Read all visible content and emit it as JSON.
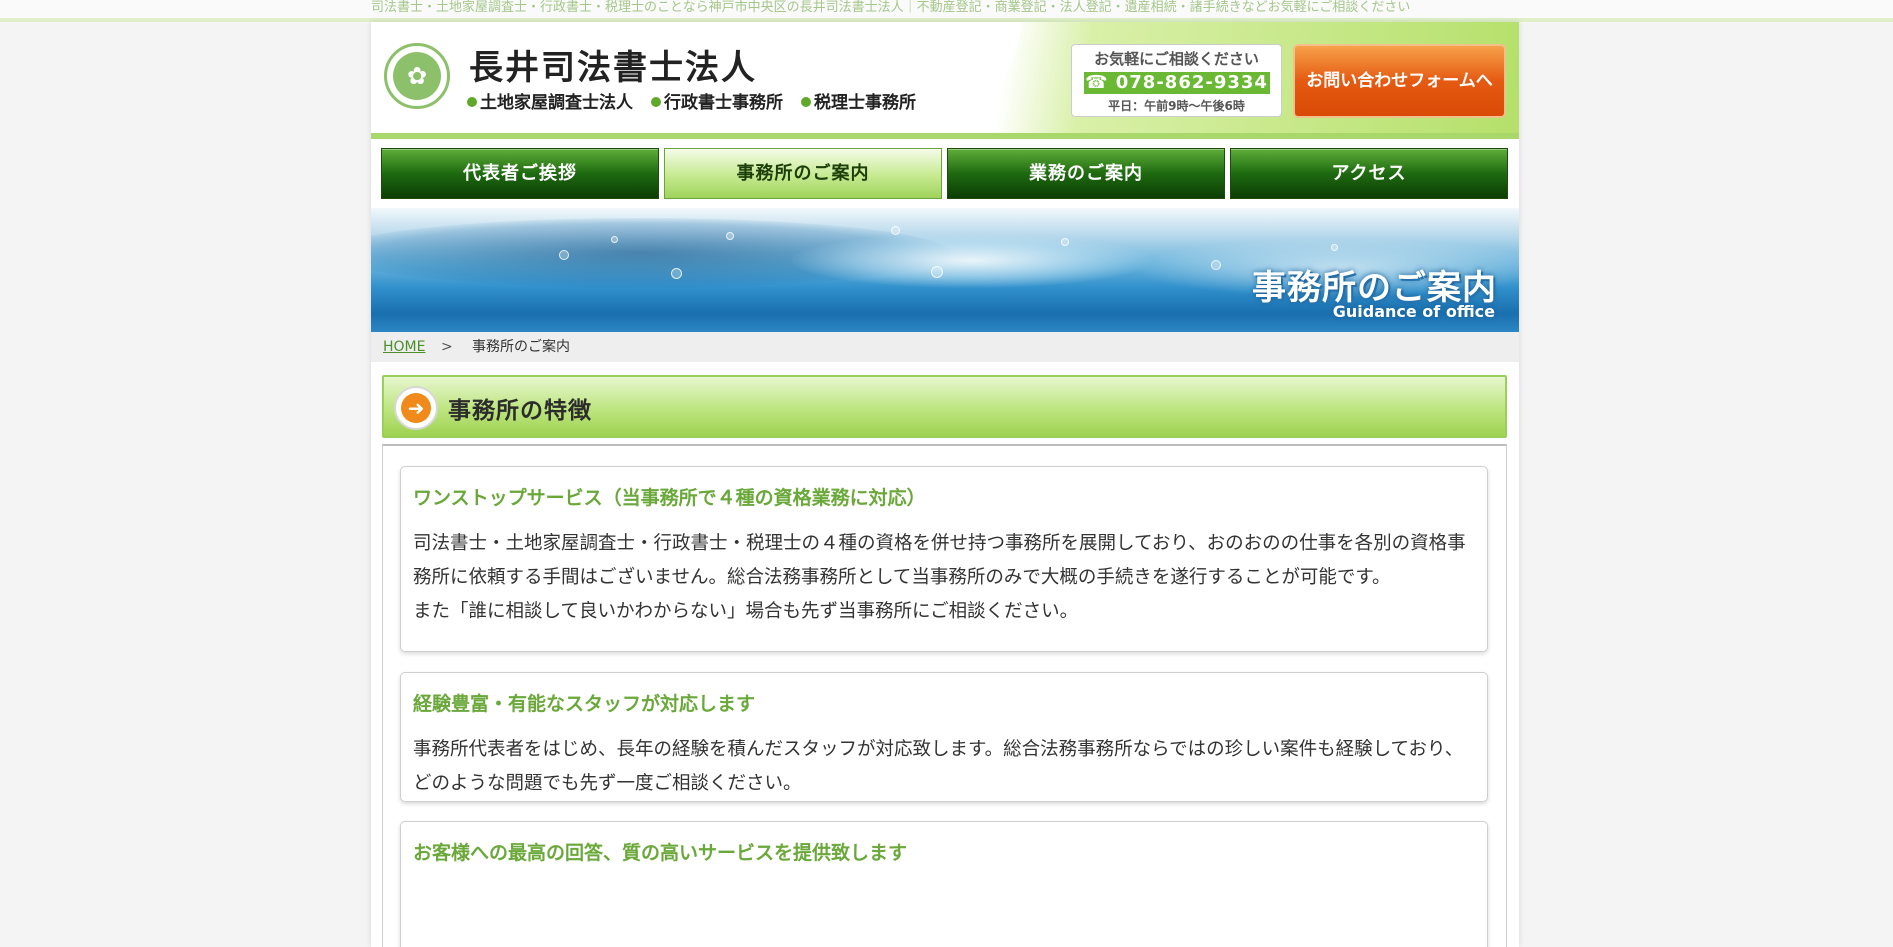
{
  "top": {
    "tagline": "司法書士・土地家屋調査士・行政書士・税理士のことなら神戸市中央区の長井司法書士法人｜不動産登記・商業登記・法人登記・遺産相続・諸手続きなどお気軽にご相談ください"
  },
  "header": {
    "site_title": "長井司法書士法人",
    "subs": [
      "土地家屋調査士法人",
      "行政書士事務所",
      "税理士事務所"
    ],
    "phone_label": "お気軽にご相談ください",
    "phone_number": "☎ 078-862-9334",
    "hours": "平日：午前9時〜午後6時",
    "contact_button": "お問い合わせフォームへ"
  },
  "nav": [
    {
      "label": "代表者ご挨拶",
      "active": false
    },
    {
      "label": "事務所のご案内",
      "active": true
    },
    {
      "label": "業務のご案内",
      "active": false
    },
    {
      "label": "アクセス",
      "active": false
    }
  ],
  "banner": {
    "title": "事務所のご案内",
    "subtitle": "Guidance of office"
  },
  "breadcrumb": {
    "home": "HOME",
    "separator": ">",
    "current": "事務所のご案内"
  },
  "section": {
    "title": "事務所の特徴"
  },
  "cards": [
    {
      "title": "ワンストップサービス（当事務所で４種の資格業務に対応）",
      "lines": [
        "司法書士・土地家屋調査士・行政書士・税理士の４種の資格を併せ持つ事務所を展開しており、おのおのの仕事を各別の資格事務所に依頼する手間はございません。総合法務事務所として当事務所のみで大概の手続きを遂行することが可能です。",
        "また「誰に相談して良いかわからない」場合も先ず当事務所にご相談ください。"
      ]
    },
    {
      "title": "経験豊富・有能なスタッフが対応します",
      "lines": [
        "事務所代表者をはじめ、長年の経験を積んだスタッフが対応致します。総合法務事務所ならではの珍しい案件も経験しており、どのような問題でも先ず一度ご相談ください。"
      ]
    },
    {
      "title": "お客様への最高の回答、質の高いサービスを提供致します",
      "lines": []
    }
  ],
  "colors": {
    "accent_green": "#6aa83a",
    "nav_dark_green": "#1e6a10",
    "contact_orange": "#e55a12"
  }
}
